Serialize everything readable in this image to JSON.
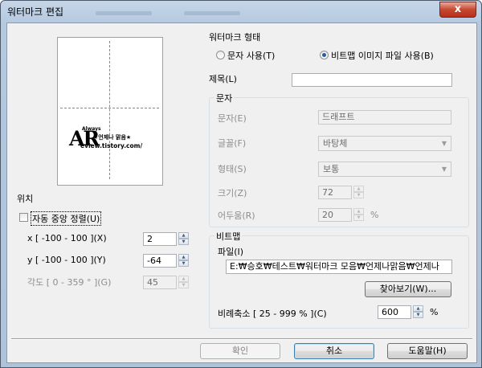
{
  "window": {
    "title": "워터마크 편집",
    "close_glyph": "x"
  },
  "preview": {
    "wm_big": "AR",
    "wm_always": "Always",
    "wm_star": "★언제나 맑음★",
    "wm_url": "eview.tistory.com/"
  },
  "position": {
    "heading": "위치",
    "auto_center": "자동 중앙 정렬(U)",
    "x_label": "x [ -100 - 100 ](X)",
    "x_value": "2",
    "y_label": "y [ -100 - 100 ](Y)",
    "y_value": "-64",
    "angle_label": "각도 [ 0 - 359 ° ](G)",
    "angle_value": "45"
  },
  "type": {
    "heading": "워터마크 형태",
    "option_text": "문자 사용(T)",
    "option_bitmap": "비트맵 이미지 파일 사용(B)",
    "selected": "bitmap"
  },
  "title_field": {
    "label": "제목(L)",
    "value": ""
  },
  "text_group": {
    "heading": "문자",
    "text_label": "문자(E)",
    "text_value": "드래프트",
    "font_label": "글꼴(F)",
    "font_value": "바탕체",
    "style_label": "형태(S)",
    "style_value": "보통",
    "size_label": "크기(Z)",
    "size_value": "72",
    "dark_label": "어두움(R)",
    "dark_value": "20",
    "dark_unit": "%"
  },
  "bitmap_group": {
    "heading": "비트맵",
    "file_label": "파일(I)",
    "file_value": "E:₩승호₩테스트₩워터마크 모음₩언제나맑음₩언제나",
    "browse_button": "찾아보기(W)...",
    "scale_label": "비례축소 [ 25 - 999 % ](C)",
    "scale_value": "600",
    "scale_unit": "%"
  },
  "buttons": {
    "ok": "확인",
    "cancel": "취소",
    "help": "도움말(H)"
  }
}
